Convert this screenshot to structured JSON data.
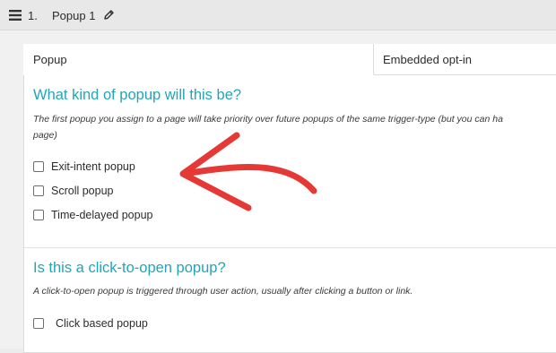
{
  "header": {
    "item_number": "1.",
    "title": "Popup 1",
    "icons": {
      "drag": "drag-handle-icon",
      "edit": "pencil-icon"
    }
  },
  "tabs": [
    {
      "label": "Popup",
      "active": true
    },
    {
      "label": "Embedded opt-in",
      "active": false
    }
  ],
  "popup_kind": {
    "heading": "What kind of popup will this be?",
    "description_line1": "The first popup you assign to a page will take priority over future popups of the same trigger-type (but you can ha",
    "description_line2": "page)",
    "options": [
      {
        "label": "Exit-intent popup",
        "checked": false
      },
      {
        "label": "Scroll popup",
        "checked": false
      },
      {
        "label": "Time-delayed popup",
        "checked": false
      }
    ]
  },
  "click_to_open": {
    "heading": "Is this a click-to-open popup?",
    "description": "A click-to-open popup is triggered through user action, usually after clicking a button or link.",
    "options": [
      {
        "label": "Click based popup",
        "checked": false
      }
    ]
  },
  "colors": {
    "heading": "#22a5b5",
    "annotation_arrow": "#e53935"
  }
}
